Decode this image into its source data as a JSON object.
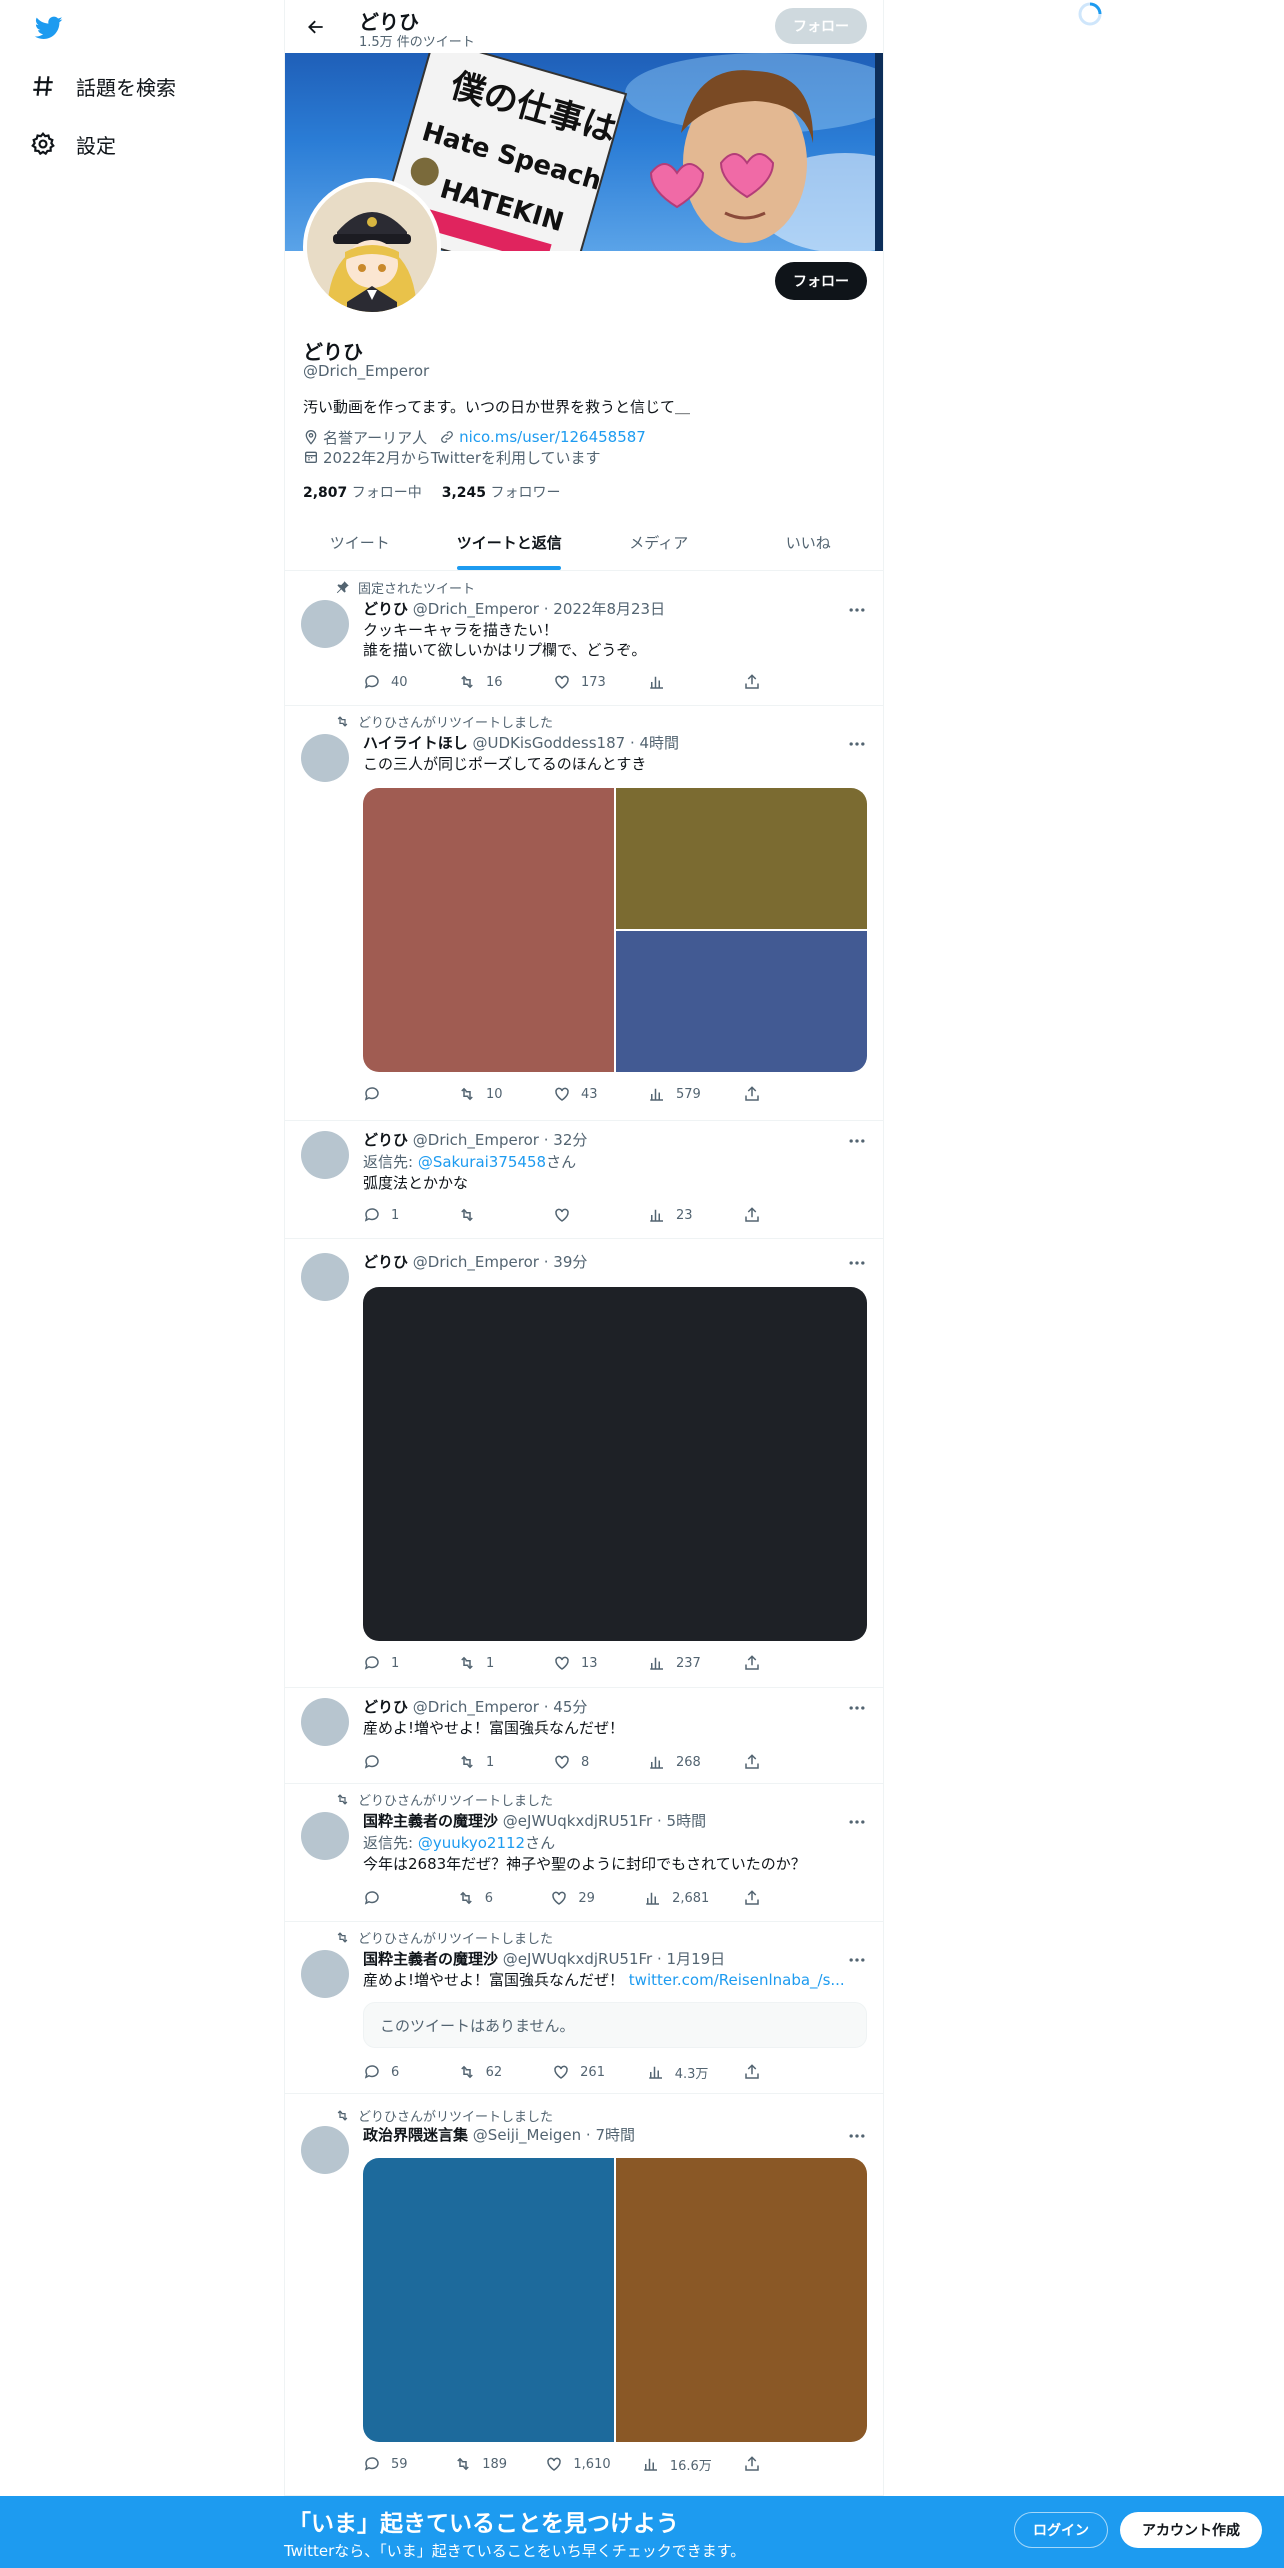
{
  "sidebar": {
    "items": [
      {
        "label": "話題を検索",
        "icon": "hashtag-icon"
      },
      {
        "label": "設定",
        "icon": "gear-icon"
      }
    ]
  },
  "header": {
    "name": "どりひ",
    "tweet_count": "1.5万 件のツイート",
    "follow_label": "フォロー"
  },
  "banner": {
    "sign_line1": "僕の仕事は",
    "sign_line2": "Hate Speach",
    "sign_line3": "HATEKIN"
  },
  "profile": {
    "follow_label": "フォロー",
    "name": "どりひ",
    "handle": "@Drich_Emperor",
    "bio": "汚い動画を作ってます。いつの日か世界を救うと信じて＿",
    "location": "名誉アーリア人",
    "url": "nico.ms/user/126458587",
    "joined": "2022年2月からTwitterを利用しています",
    "following_count": "2,807",
    "following_label": "フォロー中",
    "followers_count": "3,245",
    "followers_label": "フォロワー"
  },
  "tabs": [
    "ツイート",
    "ツイートと返信",
    "メディア",
    "いいね"
  ],
  "tweets": [
    {
      "context": "固定されたツイート",
      "name": "どりひ",
      "handle": "@Drich_Emperor",
      "time": "2022年8月23日",
      "text": "クッキーキャラを描きたい！\n誰を描いて欲しいかはリプ欄で、どうぞ。",
      "replies": "40",
      "retweets": "16",
      "likes": "173",
      "views": ""
    },
    {
      "context": "どりひさんがリツイートしました",
      "name": "ハイライトほし",
      "handle": "@UDKisGoddess187",
      "time": "4時間",
      "text": "この三人が同じポーズしてるのほんとすき",
      "media_colors": [
        "#a05c52",
        "#7b6b31",
        "#425a93"
      ],
      "replies": "",
      "retweets": "10",
      "likes": "43",
      "views": "579"
    },
    {
      "name": "どりひ",
      "handle": "@Drich_Emperor",
      "time": "32分",
      "reply_prefix": "返信先: ",
      "reply_to": "@Sakurai375458",
      "reply_suffix": "さん",
      "text": "弧度法とかかな",
      "replies": "1",
      "retweets": "",
      "likes": "",
      "views": "23"
    },
    {
      "name": "どりひ",
      "handle": "@Drich_Emperor",
      "time": "39分",
      "media_colors": [
        "#1e2126"
      ],
      "replies": "1",
      "retweets": "1",
      "likes": "13",
      "views": "237"
    },
    {
      "name": "どりひ",
      "handle": "@Drich_Emperor",
      "time": "45分",
      "text": "産めよ!増やせよ！富国強兵なんだぜ！",
      "replies": "",
      "retweets": "1",
      "likes": "8",
      "views": "268"
    },
    {
      "context": "どりひさんがリツイートしました",
      "name": "国粋主義者の魔理沙",
      "handle": "@eJWUqkxdjRU51Fr",
      "time": "5時間",
      "reply_prefix": "返信先: ",
      "reply_to": "@yuukyo2112",
      "reply_suffix": "さん",
      "text": "今年は2683年だぜ？神子や聖のように封印でもされていたのか？",
      "replies": "",
      "retweets": "6",
      "likes": "29",
      "views": "2,681"
    },
    {
      "context": "どりひさんがリツイートしました",
      "name": "国粋主義者の魔理沙",
      "handle": "@eJWUqkxdjRU51Fr",
      "time": "1月19日",
      "text": "産めよ!増やせよ！富国強兵なんだぜ！",
      "link": "twitter.com/Reisenlnaba_/s...",
      "quote": "このツイートはありません。",
      "replies": "6",
      "retweets": "62",
      "likes": "261",
      "views": "4.3万"
    },
    {
      "context": "どりひさんがリツイートしました",
      "name": "政治界隈迷言集",
      "handle": "@Seiji_Meigen",
      "time": "7時間",
      "media_colors": [
        "#1d6a9c",
        "#8a5826"
      ],
      "replies": "59",
      "retweets": "189",
      "likes": "1,610",
      "views": "16.6万"
    }
  ],
  "bottom_bar": {
    "title": "「いま」起きていることを見つけよう",
    "subtitle": "Twitterなら、「いま」起きていることをいち早くチェックできます。",
    "login": "ログイン",
    "signup": "アカウント作成"
  }
}
